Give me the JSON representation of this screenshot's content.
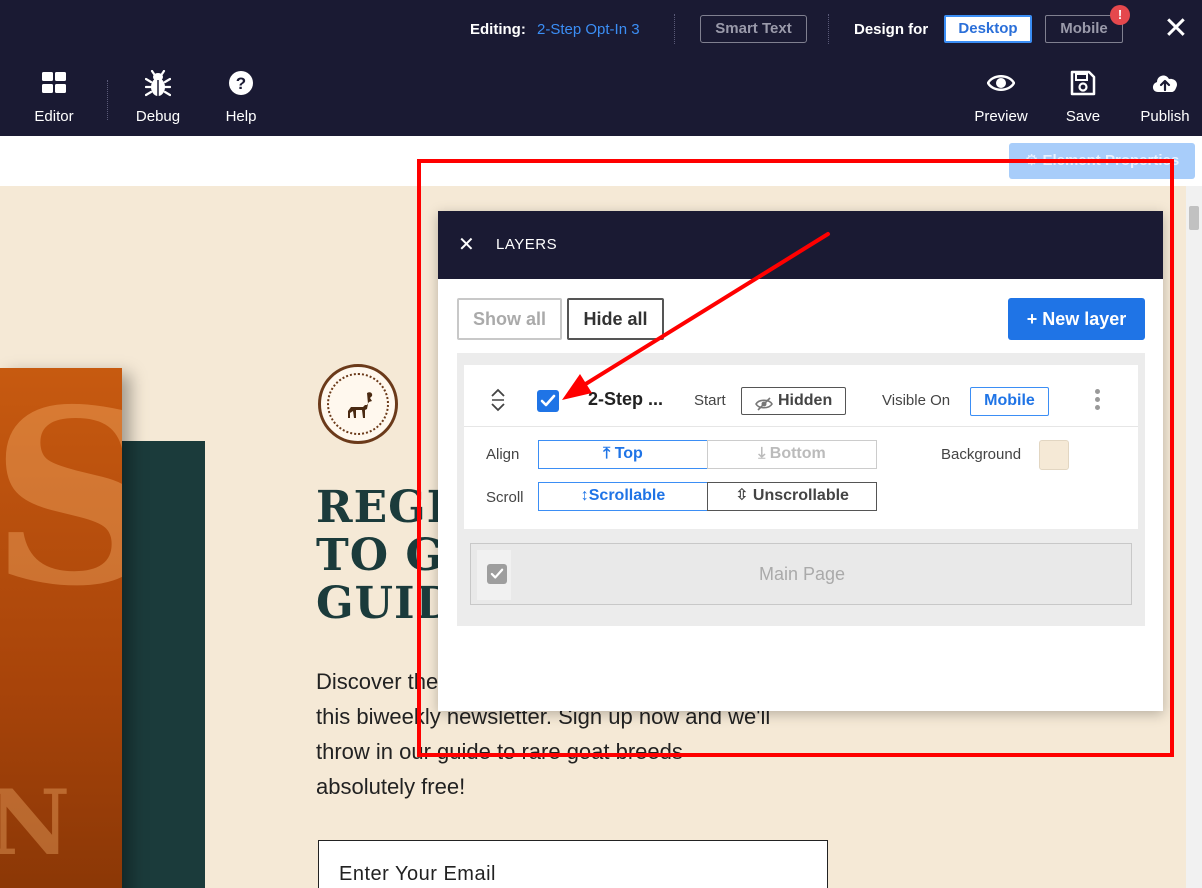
{
  "topbar": {
    "editing_label": "Editing:",
    "editing_name": "2-Step Opt-In 3",
    "smart_text": "Smart Text",
    "design_for": "Design for",
    "desktop": "Desktop",
    "mobile": "Mobile",
    "alert_badge": "!",
    "close": "✕",
    "tools_left": [
      {
        "label": "Editor",
        "icon": "grid-icon"
      },
      {
        "label": "Debug",
        "icon": "bug-icon"
      },
      {
        "label": "Help",
        "icon": "help-icon"
      }
    ],
    "tools_right": [
      {
        "label": "Preview",
        "icon": "eye-icon"
      },
      {
        "label": "Save",
        "icon": "save-icon"
      },
      {
        "label": "Publish",
        "icon": "cloud-upload-icon"
      }
    ]
  },
  "element_properties": "Element Properties",
  "canvas": {
    "headline_lines": [
      "REGI",
      "TO G",
      "GUID"
    ],
    "body_lines": [
      "Discover the",
      "this biweekly newsletter.  Sign up now and we'll",
      "throw in our guide to rare goat breeds",
      "absolutely free!"
    ],
    "email_placeholder": "Enter Your Email"
  },
  "layers": {
    "title": "LAYERS",
    "close": "✕",
    "show_all": "Show all",
    "hide_all": "Hide all",
    "new_layer": "+ New layer",
    "layer": {
      "name": "2-Step ...",
      "checked": true,
      "start_label": "Start",
      "start_value": "Hidden",
      "visible_on_label": "Visible On",
      "visible_on_value": "Mobile",
      "align_label": "Align",
      "align_top": "Top",
      "align_bottom": "Bottom",
      "align_selected": "Top",
      "background_label": "Background",
      "background_color": "#f5e9d6",
      "scroll_label": "Scroll",
      "scroll_scrollable": "Scrollable",
      "scroll_unscrollable": "Unscrollable",
      "scroll_selected": "Scrollable"
    },
    "main_page": {
      "label": "Main Page",
      "checked": true
    }
  },
  "colors": {
    "topbar_bg": "#1a1a33",
    "accent": "#1f74e6",
    "annotation": "#ff0000",
    "page_bg": "#f5e9d6",
    "page_green": "#1b3b3b"
  }
}
